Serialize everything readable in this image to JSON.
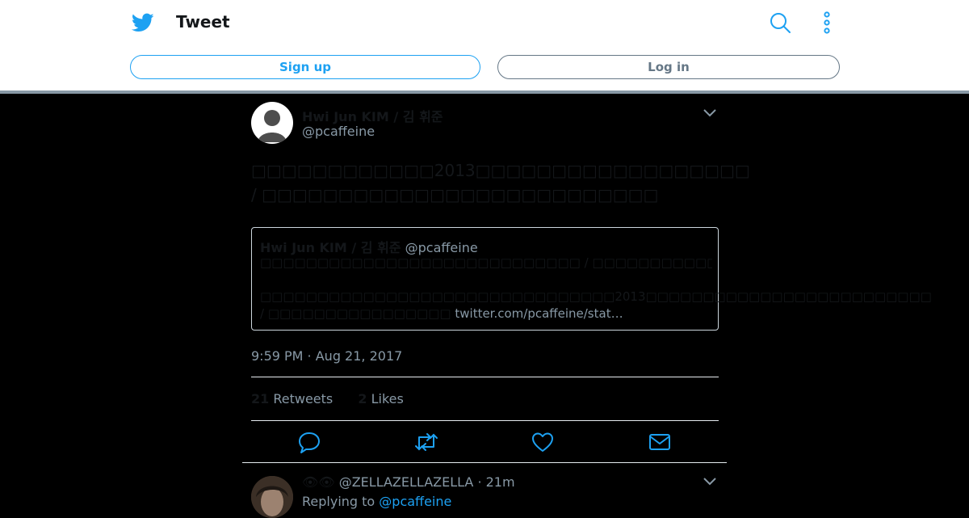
{
  "header": {
    "title": "Tweet",
    "signup_label": "Sign up",
    "login_label": "Log in"
  },
  "tweet": {
    "author_name": "Hwi Jun KIM / 김 휘준",
    "author_handle": "@pcaffeine",
    "text": "□□□□□□□□□□□□2013□□□□□□□□□□□□□□□□□□ / □□□□□□□□□□□□□□□□□□□□□□□□□□",
    "quoted": {
      "author_name": "Hwi Jun KIM / 김 휘준",
      "author_handle": "@pcaffeine",
      "line1": "□□□□□□□□□□□□□□□□□□□□□□□□□□□□ / □□□□□□□□□□□□□□□□□□□□□□□□□□□□□□",
      "line2": "□□□□□□□□□□□□□□□□□□□□□□□□□□□□□□□2013□□□□□□□□□□□□□□□□□□□□□□□□□ / □□□□□□□□□□□□□□□□",
      "link": "twitter.com/pcaffeine/stat…"
    },
    "timestamp": "9:59 PM · Aug 21, 2017",
    "retweets_count": "21",
    "retweets_label": "Retweets",
    "likes_count": "2",
    "likes_label": "Likes"
  },
  "reply": {
    "emoji": "👁👁",
    "handle": "@ZELLAZELLAZELLA",
    "time": "· 21m",
    "replying_prefix": "Replying to",
    "replying_handle": "@pcaffeine"
  },
  "colors": {
    "brand": "#1da1f2",
    "muted": "#8899a6",
    "background": "#000000"
  }
}
